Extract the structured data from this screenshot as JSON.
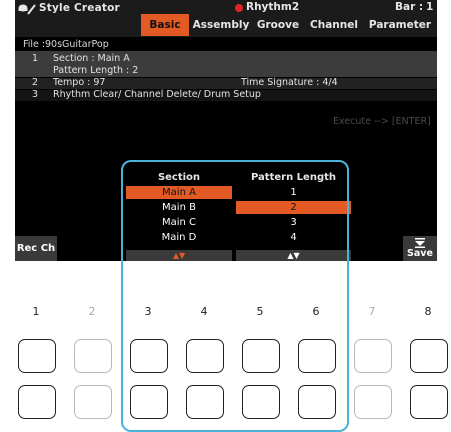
{
  "header": {
    "app_icon": "style-creator-icon",
    "title": "Style Creator",
    "style_name": "Rhythm2",
    "bar_label": "Bar :",
    "bar_value": "1",
    "rec_color": "#e52222",
    "accent_color": "#e35a25"
  },
  "tabs": [
    {
      "label": "Basic",
      "active": true
    },
    {
      "label": "Assembly",
      "active": false
    },
    {
      "label": "Groove",
      "active": false
    },
    {
      "label": "Channel",
      "active": false
    },
    {
      "label": "Parameter",
      "active": false
    }
  ],
  "file": {
    "label": "File :",
    "name": "90sGuitarPop"
  },
  "items": {
    "row1": {
      "number": "1",
      "section": "Section : Main A",
      "pattern_length": "Pattern Length : 2"
    },
    "row2": {
      "number": "2",
      "tempo": "Tempo : 97",
      "time_signature": "Time Signature : 4/4"
    },
    "row3": {
      "number": "3",
      "text": "Rhythm Clear/ Channel Delete/ Drum Setup"
    }
  },
  "execute_hint": "Execute --> [ENTER]",
  "panel": {
    "section_header": "Section",
    "pattern_header": "Pattern Length",
    "sections": [
      "Main A",
      "Main B",
      "Main C",
      "Main D"
    ],
    "selected_section": "Main A",
    "lengths": [
      "1",
      "2",
      "3",
      "4"
    ],
    "selected_length": "2",
    "section_arrows": "▲▼",
    "length_arrows": "▲▼"
  },
  "rec_ch_label": "Rec Ch",
  "save_label": "Save",
  "buttons": {
    "numbers": [
      "1",
      "2",
      "3",
      "4",
      "5",
      "6",
      "7",
      "8"
    ],
    "dimmed": [
      "2",
      "7"
    ],
    "highlight_color": "#4ab3d9"
  }
}
